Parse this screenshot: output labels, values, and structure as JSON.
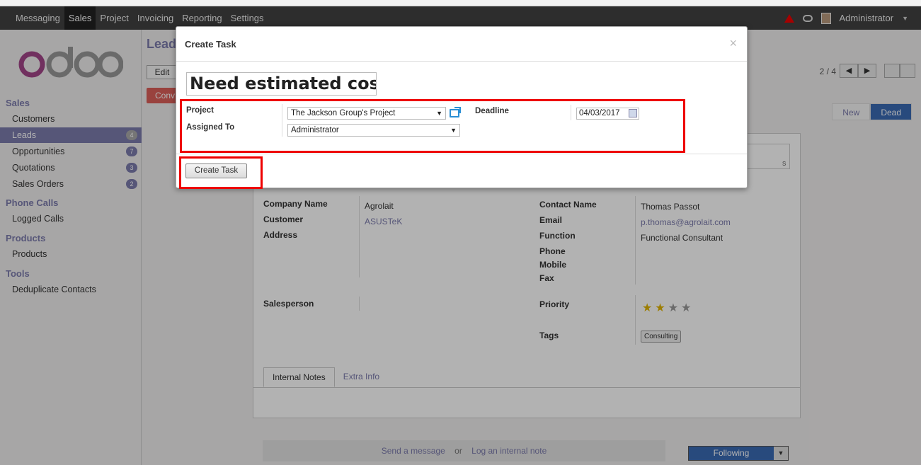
{
  "topbar": {
    "menu": [
      "Messaging",
      "Sales",
      "Project",
      "Invoicing",
      "Reporting",
      "Settings"
    ],
    "active_menu": "Sales",
    "user": "Administrator"
  },
  "sidebar": {
    "logo_text": "odoo",
    "sections": [
      {
        "title": "Sales",
        "items": [
          {
            "label": "Customers",
            "badge": ""
          },
          {
            "label": "Leads",
            "badge": "4"
          },
          {
            "label": "Opportunities",
            "badge": "7"
          },
          {
            "label": "Quotations",
            "badge": "3"
          },
          {
            "label": "Sales Orders",
            "badge": "2"
          }
        ]
      },
      {
        "title": "Phone Calls",
        "items": [
          {
            "label": "Logged Calls",
            "badge": ""
          }
        ]
      },
      {
        "title": "Products",
        "items": [
          {
            "label": "Products",
            "badge": ""
          }
        ]
      },
      {
        "title": "Tools",
        "items": [
          {
            "label": "Deduplicate Contacts",
            "badge": ""
          }
        ]
      }
    ]
  },
  "main": {
    "breadcrumb": "Leads",
    "edit_label": "Edit",
    "convert_label": "Conv",
    "pager": "2 / 4",
    "stages": [
      "New",
      "Dead"
    ],
    "current_stage": "Dead",
    "form": {
      "company_name_label": "Company Name",
      "company_name": "Agrolait",
      "customer_label": "Customer",
      "customer": "ASUSTeK",
      "address_label": "Address",
      "salesperson_label": "Salesperson",
      "contact_name_label": "Contact Name",
      "contact_name": "Thomas Passot",
      "email_label": "Email",
      "email": "p.thomas@agrolait.com",
      "function_label": "Function",
      "function": "Functional Consultant",
      "phone_label": "Phone",
      "mobile_label": "Mobile",
      "fax_label": "Fax",
      "priority_label": "Priority",
      "priority_stars": 2,
      "priority_max": 4,
      "tags_label": "Tags",
      "tag": "Consulting",
      "tab_notes": "Internal Notes",
      "tab_extra": "Extra Info",
      "sheet_partial_text": "s"
    },
    "chatter": {
      "send_message": "Send a message",
      "or": "or",
      "log_note": "Log an internal note",
      "following": "Following"
    }
  },
  "modal": {
    "title": "Create Task",
    "close": "×",
    "task_name": "Need estimated cost for",
    "project_label": "Project",
    "project_value": "The Jackson Group's Project",
    "assigned_label": "Assigned To",
    "assigned_value": "Administrator",
    "deadline_label": "Deadline",
    "deadline_value": "04/03/2017",
    "create_button": "Create Task"
  },
  "colors": {
    "accent": "#7c7bad",
    "highlight": "#ee0000",
    "topbar": "#414141"
  }
}
